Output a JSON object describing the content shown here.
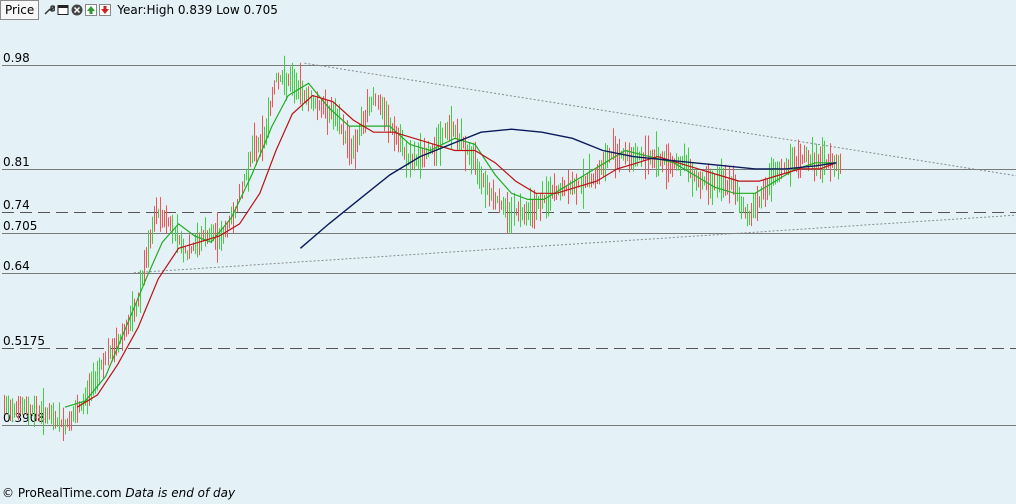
{
  "header": {
    "price_label": "Price",
    "text": "Year:High 0.839 Low 0.705"
  },
  "footer": {
    "source": "© ProRealTime.com",
    "note": "Data is end of day"
  },
  "icons": [
    "wrench-icon",
    "window-icon",
    "close-icon",
    "move-up-icon",
    "move-down-icon"
  ],
  "colors": {
    "background": "#e4f2f8",
    "candle": "#44cc44",
    "candle_down": "#ee5555",
    "ma_short": "#22aa22",
    "ma_medium": "#bb1111",
    "ma_long": "#0b1a5a",
    "grid": "#7a7a7a",
    "trendline": "#8a8a8a"
  },
  "chart_data": {
    "type": "line",
    "ylabel_ticks": [
      0.98,
      0.81,
      0.74,
      0.705,
      0.64,
      0.5175,
      0.3908
    ],
    "ylim": [
      0.35,
      1.0
    ],
    "grid_levels": [
      {
        "value": 0.98,
        "style": "solid"
      },
      {
        "value": 0.81,
        "style": "solid"
      },
      {
        "value": 0.74,
        "style": "dashed"
      },
      {
        "value": 0.705,
        "style": "solid"
      },
      {
        "value": 0.64,
        "style": "solid"
      },
      {
        "value": 0.5175,
        "style": "dashed"
      },
      {
        "value": 0.3908,
        "style": "solid"
      }
    ],
    "bars_x": [
      0,
      400
    ],
    "price_path": [
      [
        0,
        0.42
      ],
      [
        10,
        0.42
      ],
      [
        20,
        0.41
      ],
      [
        30,
        0.39
      ],
      [
        38,
        0.42
      ],
      [
        48,
        0.49
      ],
      [
        55,
        0.52
      ],
      [
        65,
        0.58
      ],
      [
        75,
        0.74
      ],
      [
        82,
        0.72
      ],
      [
        90,
        0.67
      ],
      [
        98,
        0.7
      ],
      [
        108,
        0.7
      ],
      [
        115,
        0.75
      ],
      [
        122,
        0.84
      ],
      [
        128,
        0.86
      ],
      [
        134,
        0.96
      ],
      [
        142,
        0.95
      ],
      [
        152,
        0.92
      ],
      [
        162,
        0.9
      ],
      [
        172,
        0.84
      ],
      [
        182,
        0.93
      ],
      [
        190,
        0.88
      ],
      [
        200,
        0.82
      ],
      [
        210,
        0.84
      ],
      [
        220,
        0.88
      ],
      [
        230,
        0.83
      ],
      [
        240,
        0.77
      ],
      [
        248,
        0.74
      ],
      [
        255,
        0.74
      ],
      [
        262,
        0.75
      ],
      [
        270,
        0.77
      ],
      [
        280,
        0.78
      ],
      [
        292,
        0.8
      ],
      [
        300,
        0.84
      ],
      [
        308,
        0.83
      ],
      [
        318,
        0.83
      ],
      [
        328,
        0.82
      ],
      [
        336,
        0.82
      ],
      [
        342,
        0.79
      ],
      [
        350,
        0.79
      ],
      [
        360,
        0.78
      ],
      [
        366,
        0.73
      ],
      [
        372,
        0.76
      ],
      [
        380,
        0.8
      ],
      [
        388,
        0.82
      ],
      [
        395,
        0.83
      ],
      [
        400,
        0.82
      ],
      [
        405,
        0.82
      ],
      [
        412,
        0.82
      ]
    ],
    "series": [
      {
        "color_key": "ma_short",
        "values": [
          [
            30,
            0.42
          ],
          [
            40,
            0.43
          ],
          [
            50,
            0.47
          ],
          [
            60,
            0.55
          ],
          [
            70,
            0.63
          ],
          [
            78,
            0.69
          ],
          [
            86,
            0.72
          ],
          [
            94,
            0.7
          ],
          [
            102,
            0.69
          ],
          [
            112,
            0.73
          ],
          [
            122,
            0.8
          ],
          [
            132,
            0.88
          ],
          [
            140,
            0.93
          ],
          [
            150,
            0.95
          ],
          [
            160,
            0.91
          ],
          [
            170,
            0.88
          ],
          [
            180,
            0.88
          ],
          [
            190,
            0.88
          ],
          [
            200,
            0.85
          ],
          [
            210,
            0.84
          ],
          [
            222,
            0.86
          ],
          [
            232,
            0.85
          ],
          [
            242,
            0.8
          ],
          [
            250,
            0.77
          ],
          [
            258,
            0.76
          ],
          [
            266,
            0.76
          ],
          [
            276,
            0.78
          ],
          [
            286,
            0.8
          ],
          [
            296,
            0.82
          ],
          [
            306,
            0.84
          ],
          [
            318,
            0.83
          ],
          [
            330,
            0.82
          ],
          [
            340,
            0.8
          ],
          [
            350,
            0.78
          ],
          [
            360,
            0.77
          ],
          [
            370,
            0.77
          ],
          [
            380,
            0.79
          ],
          [
            390,
            0.81
          ],
          [
            400,
            0.82
          ],
          [
            410,
            0.82
          ]
        ]
      },
      {
        "color_key": "ma_medium",
        "values": [
          [
            36,
            0.42
          ],
          [
            46,
            0.44
          ],
          [
            56,
            0.49
          ],
          [
            66,
            0.55
          ],
          [
            76,
            0.63
          ],
          [
            86,
            0.68
          ],
          [
            96,
            0.69
          ],
          [
            106,
            0.7
          ],
          [
            116,
            0.72
          ],
          [
            126,
            0.77
          ],
          [
            134,
            0.84
          ],
          [
            142,
            0.9
          ],
          [
            152,
            0.93
          ],
          [
            162,
            0.92
          ],
          [
            172,
            0.89
          ],
          [
            182,
            0.87
          ],
          [
            192,
            0.87
          ],
          [
            202,
            0.86
          ],
          [
            212,
            0.85
          ],
          [
            222,
            0.84
          ],
          [
            232,
            0.84
          ],
          [
            242,
            0.82
          ],
          [
            252,
            0.79
          ],
          [
            262,
            0.77
          ],
          [
            272,
            0.77
          ],
          [
            282,
            0.78
          ],
          [
            292,
            0.79
          ],
          [
            302,
            0.81
          ],
          [
            312,
            0.82
          ],
          [
            322,
            0.83
          ],
          [
            332,
            0.82
          ],
          [
            342,
            0.81
          ],
          [
            352,
            0.8
          ],
          [
            362,
            0.79
          ],
          [
            372,
            0.79
          ],
          [
            382,
            0.8
          ],
          [
            392,
            0.81
          ],
          [
            402,
            0.81
          ],
          [
            410,
            0.82
          ]
        ]
      },
      {
        "color_key": "ma_long",
        "values": [
          [
            146,
            0.68
          ],
          [
            160,
            0.72
          ],
          [
            175,
            0.76
          ],
          [
            190,
            0.8
          ],
          [
            205,
            0.83
          ],
          [
            220,
            0.85
          ],
          [
            235,
            0.87
          ],
          [
            250,
            0.875
          ],
          [
            265,
            0.87
          ],
          [
            280,
            0.86
          ],
          [
            295,
            0.84
          ],
          [
            310,
            0.83
          ],
          [
            325,
            0.825
          ],
          [
            340,
            0.82
          ],
          [
            355,
            0.815
          ],
          [
            370,
            0.81
          ],
          [
            385,
            0.81
          ],
          [
            400,
            0.815
          ],
          [
            410,
            0.82
          ]
        ]
      }
    ],
    "trendlines": [
      {
        "from": [
          148,
          0.983
        ],
        "to": [
          502,
          0.797
        ]
      },
      {
        "from": [
          64,
          0.64
        ],
        "to": [
          502,
          0.735
        ]
      }
    ]
  }
}
